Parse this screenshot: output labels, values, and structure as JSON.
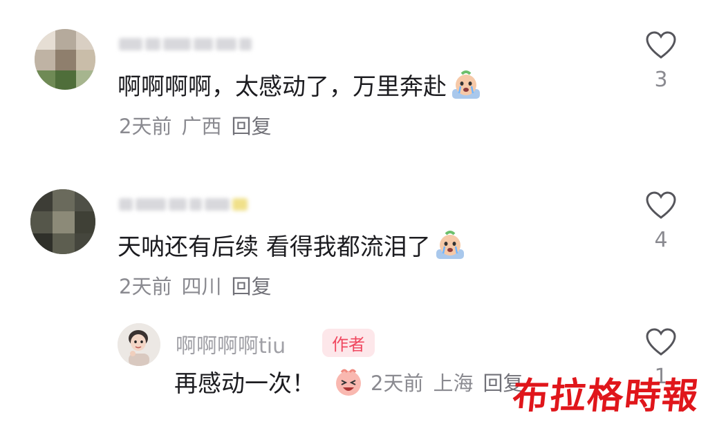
{
  "comments": [
    {
      "text": "啊啊啊啊，太感动了，万里奔赴",
      "sticker": "crying-face-sticker",
      "time": "2天前",
      "location": "广西",
      "reply_label": "回复",
      "likes": "3"
    },
    {
      "text": "天呐还有后续 看得我都流泪了",
      "sticker": "crying-face-sticker",
      "time": "2天前",
      "location": "四川",
      "reply_label": "回复",
      "likes": "4"
    }
  ],
  "reply": {
    "username": "啊啊啊啊tiu",
    "badge": "作者",
    "text": "再感动一次！",
    "sticker": "laughing-face-sticker",
    "time": "2天前",
    "location": "上海",
    "reply_label": "回复",
    "likes": "1"
  },
  "watermark": "布拉格時報",
  "colors": {
    "text": "#1c1c20",
    "meta": "#8a8a90",
    "badge_bg": "#fde7ea",
    "badge_text": "#f0475f",
    "watermark": "#e0161b"
  }
}
